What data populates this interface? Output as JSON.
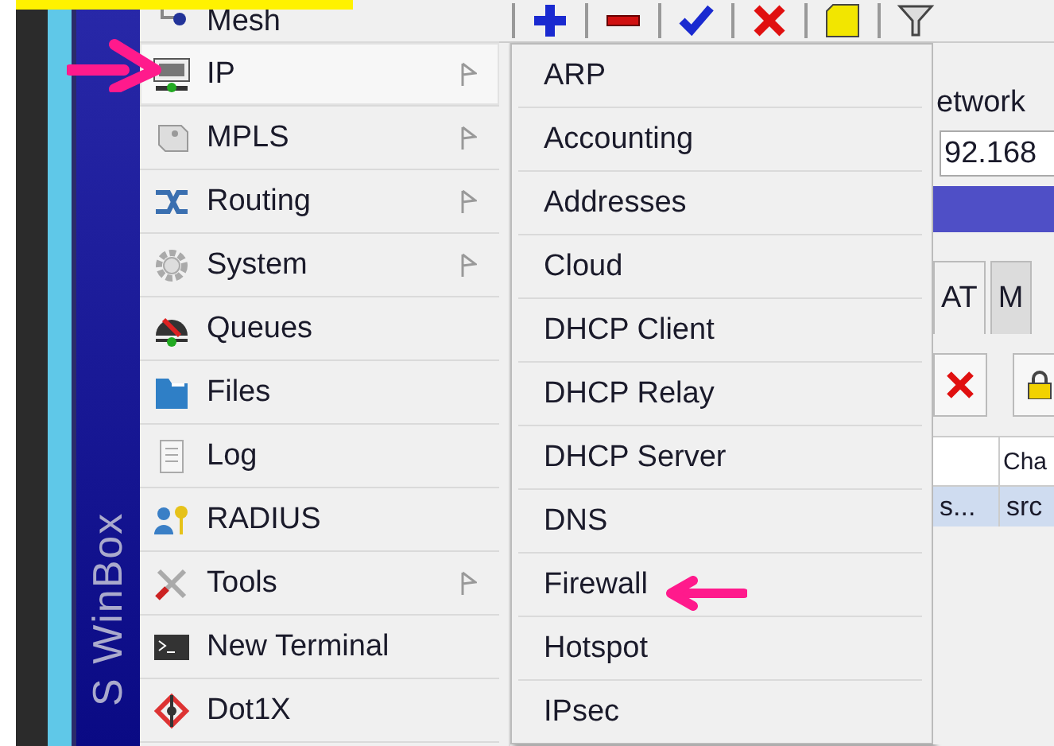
{
  "sidebar": {
    "title": "S WinBox"
  },
  "menu": {
    "items": [
      {
        "label": "Mesh",
        "has_submenu": false,
        "selected": false
      },
      {
        "label": "IP",
        "has_submenu": true,
        "selected": true
      },
      {
        "label": "MPLS",
        "has_submenu": true,
        "selected": false
      },
      {
        "label": "Routing",
        "has_submenu": true,
        "selected": false
      },
      {
        "label": "System",
        "has_submenu": true,
        "selected": false
      },
      {
        "label": "Queues",
        "has_submenu": false,
        "selected": false
      },
      {
        "label": "Files",
        "has_submenu": false,
        "selected": false
      },
      {
        "label": "Log",
        "has_submenu": false,
        "selected": false
      },
      {
        "label": "RADIUS",
        "has_submenu": false,
        "selected": false
      },
      {
        "label": "Tools",
        "has_submenu": true,
        "selected": false
      },
      {
        "label": "New Terminal",
        "has_submenu": false,
        "selected": false
      },
      {
        "label": "Dot1X",
        "has_submenu": false,
        "selected": false
      }
    ]
  },
  "submenu": {
    "items": [
      {
        "label": "ARP"
      },
      {
        "label": "Accounting"
      },
      {
        "label": "Addresses"
      },
      {
        "label": "Cloud"
      },
      {
        "label": "DHCP Client"
      },
      {
        "label": "DHCP Relay"
      },
      {
        "label": "DHCP Server"
      },
      {
        "label": "DNS"
      },
      {
        "label": "Firewall"
      },
      {
        "label": "Hotspot"
      },
      {
        "label": "IPsec"
      }
    ]
  },
  "background_window": {
    "field_label": "etwork",
    "field_value": "92.168",
    "tabs": [
      {
        "label": "AT",
        "selected": true
      },
      {
        "label": "M",
        "selected": false
      }
    ],
    "table": {
      "columns": [
        "",
        "Cha"
      ],
      "rows": [
        {
          "cells": [
            "s...",
            "src"
          ],
          "selected": true
        }
      ]
    }
  }
}
